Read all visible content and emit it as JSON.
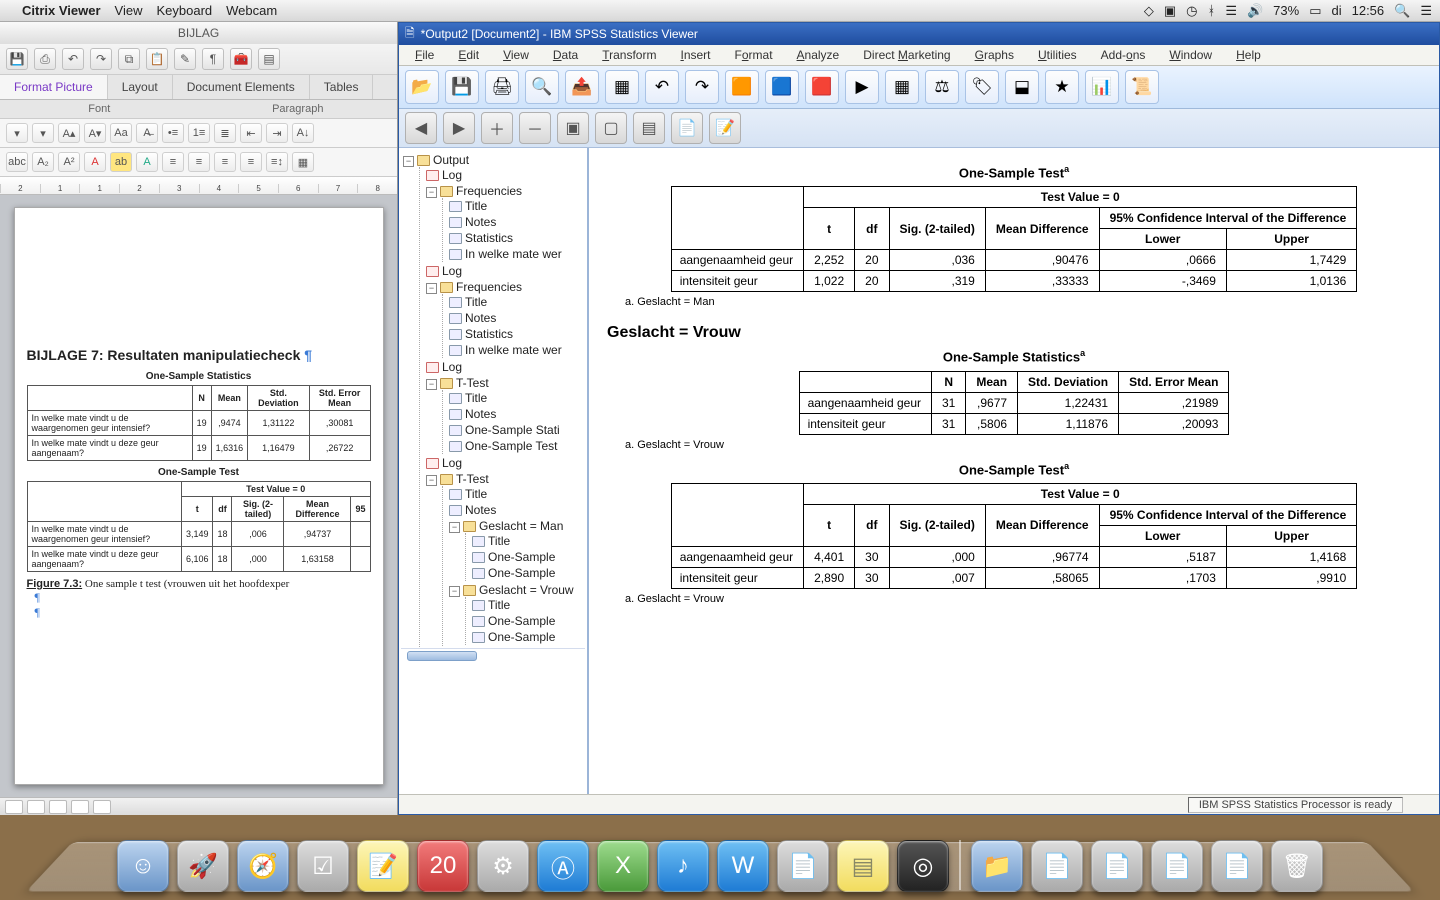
{
  "macmenu": {
    "app": "Citrix Viewer",
    "items": [
      "View",
      "Keyboard",
      "Webcam"
    ],
    "battery": "73%",
    "day": "di",
    "time": "12:56"
  },
  "word": {
    "title": "BIJLAG",
    "tabs": {
      "fp": "Format Picture",
      "layout": "Layout",
      "de": "Document Elements",
      "tables": "Tables"
    },
    "groups": {
      "font": "Font",
      "para": "Paragraph"
    },
    "ruler": [
      "2",
      "1",
      "1",
      "2",
      "3",
      "4",
      "5",
      "6",
      "7",
      "8"
    ],
    "doc": {
      "heading": "BIJLAGE 7: Resultaten manipulatiecheck",
      "tbl1": {
        "caption": "One-Sample Statistics",
        "headers": [
          "",
          "N",
          "Mean",
          "Std. Deviation",
          "Std. Error Mean"
        ],
        "rows": [
          [
            "In welke mate vindt u de waargenomen geur intensief?",
            "19",
            ",9474",
            "1,31122",
            ",30081"
          ],
          [
            "In welke mate vindt u deze geur aangenaam?",
            "19",
            "1,6316",
            "1,16479",
            ",26722"
          ]
        ]
      },
      "tbl2": {
        "caption": "One-Sample Test",
        "tv": "Test Value = 0",
        "headers": [
          "",
          "t",
          "df",
          "Sig. (2-tailed)",
          "Mean Difference",
          "95"
        ],
        "rows": [
          [
            "In welke mate vindt u de waargenomen geur intensief?",
            "3,149",
            "18",
            ",006",
            ",94737",
            ""
          ],
          [
            "In welke mate vindt u deze geur aangenaam?",
            "6,106",
            "18",
            ",000",
            "1,63158",
            ""
          ]
        ]
      },
      "fig": "Figure 7.3: One sample t test (vrouwen uit het hoofdexper"
    }
  },
  "spss": {
    "title": "*Output2 [Document2] - IBM SPSS Statistics Viewer",
    "menu": [
      "File",
      "Edit",
      "View",
      "Data",
      "Transform",
      "Insert",
      "Format",
      "Analyze",
      "Direct Marketing",
      "Graphs",
      "Utilities",
      "Add-ons",
      "Window",
      "Help"
    ],
    "menu_u": [
      "F",
      "E",
      "V",
      "D",
      "T",
      "I",
      "o",
      "A",
      "M",
      "G",
      "U",
      "",
      "W",
      "H"
    ],
    "tree": {
      "root": "Output",
      "nodes": [
        {
          "l": "Log"
        },
        {
          "l": "Frequencies",
          "c": [
            "Title",
            "Notes",
            "Statistics",
            "In welke mate wer"
          ]
        },
        {
          "l": "Log"
        },
        {
          "l": "Frequencies",
          "c": [
            "Title",
            "Notes",
            "Statistics",
            "In welke mate wer"
          ]
        },
        {
          "l": "Log"
        },
        {
          "l": "T-Test",
          "c": [
            "Title",
            "Notes",
            "One-Sample Stati",
            "One-Sample Test"
          ]
        },
        {
          "l": "Log"
        },
        {
          "l": "T-Test",
          "c": [
            "Title",
            "Notes",
            {
              "l": "Geslacht = Man",
              "c": [
                "Title",
                "One-Sample",
                "One-Sample"
              ]
            },
            {
              "l": "Geslacht = Vrouw",
              "c": [
                "Title",
                "One-Sample",
                "One-Sample"
              ]
            }
          ]
        }
      ]
    },
    "content": {
      "t1": {
        "title": "One-Sample Test",
        "tv": "Test Value = 0",
        "ci": "95% Confidence Interval of the Difference",
        "h": [
          "t",
          "df",
          "Sig. (2-tailed)",
          "Mean Difference",
          "Lower",
          "Upper"
        ],
        "rows": [
          [
            "aangenaamheid geur",
            "2,252",
            "20",
            ",036",
            ",90476",
            ",0666",
            "1,7429"
          ],
          [
            "intensiteit geur",
            "1,022",
            "20",
            ",319",
            ",33333",
            "-,3469",
            "1,0136"
          ]
        ],
        "note": "a. Geslacht = Man"
      },
      "split": "Geslacht = Vrouw",
      "t2": {
        "title": "One-Sample Statistics",
        "h": [
          "N",
          "Mean",
          "Std. Deviation",
          "Std. Error Mean"
        ],
        "rows": [
          [
            "aangenaamheid geur",
            "31",
            ",9677",
            "1,22431",
            ",21989"
          ],
          [
            "intensiteit geur",
            "31",
            ",5806",
            "1,11876",
            ",20093"
          ]
        ],
        "note": "a. Geslacht = Vrouw"
      },
      "t3": {
        "title": "One-Sample Test",
        "tv": "Test Value = 0",
        "ci": "95% Confidence Interval of the Difference",
        "h": [
          "t",
          "df",
          "Sig. (2-tailed)",
          "Mean Difference",
          "Lower",
          "Upper"
        ],
        "rows": [
          [
            "aangenaamheid geur",
            "4,401",
            "30",
            ",000",
            ",96774",
            ",5187",
            "1,4168"
          ],
          [
            "intensiteit geur",
            "2,890",
            "30",
            ",007",
            ",58065",
            ",1703",
            ",9910"
          ]
        ],
        "note": "a. Geslacht = Vrouw"
      }
    },
    "status": "IBM SPSS Statistics Processor is ready"
  }
}
